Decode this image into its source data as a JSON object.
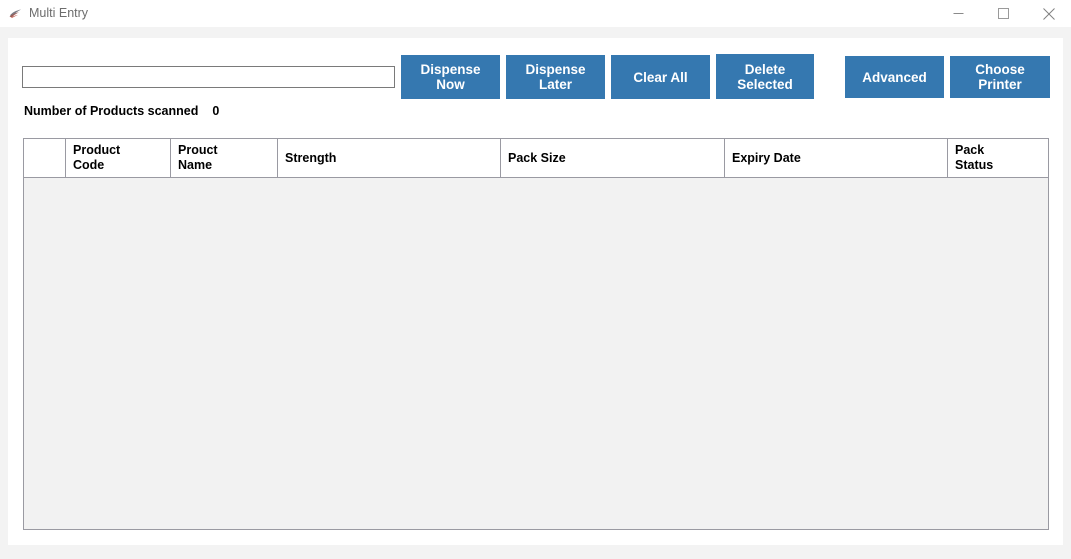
{
  "window": {
    "title": "Multi Entry",
    "icon": "app-icon",
    "controls": {
      "minimize": "minimize-icon",
      "maximize": "maximize-icon",
      "close": "close-icon"
    }
  },
  "toolbar": {
    "scan_input": {
      "value": "",
      "placeholder": ""
    },
    "buttons": [
      {
        "id": "dispense-now",
        "label": "Dispense\nNow"
      },
      {
        "id": "dispense-later",
        "label": "Dispense\nLater"
      },
      {
        "id": "clear-all",
        "label": "Clear All"
      },
      {
        "id": "delete-selected",
        "label": "Delete\nSelected"
      },
      {
        "id": "advanced",
        "label": "Advanced"
      },
      {
        "id": "choose-printer",
        "label": "Choose\nPrinter"
      }
    ]
  },
  "status": {
    "scanned_label": "Number of Products scanned",
    "scanned_count": "0"
  },
  "table": {
    "columns": [
      {
        "id": "select",
        "label": ""
      },
      {
        "id": "code",
        "label": "Product\nCode"
      },
      {
        "id": "name",
        "label": "Prouct\nName"
      },
      {
        "id": "strength",
        "label": "Strength"
      },
      {
        "id": "pack_size",
        "label": "Pack Size"
      },
      {
        "id": "expiry",
        "label": "Expiry Date"
      },
      {
        "id": "status",
        "label": "Pack\nStatus"
      }
    ],
    "rows": []
  },
  "colors": {
    "button_blue": "#3578b0",
    "panel_white": "#ffffff",
    "page_gray": "#f3f3f3",
    "table_body": "#f2f2f2",
    "table_border": "#9a9aa2"
  }
}
